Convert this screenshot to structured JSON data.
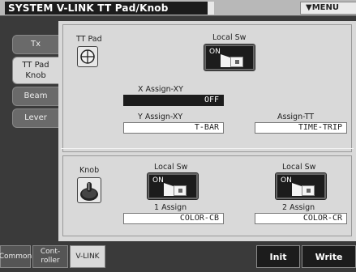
{
  "window": {
    "title": "SYSTEM V-LINK TT Pad/Knob",
    "menu_label": "▼MENU"
  },
  "side_tabs": [
    {
      "label_1": "Tx",
      "label_2": ""
    },
    {
      "label_1": "TT Pad",
      "label_2": "Knob"
    },
    {
      "label_1": "Beam",
      "label_2": ""
    },
    {
      "label_1": "Lever",
      "label_2": ""
    }
  ],
  "tt_pad": {
    "label": "TT Pad",
    "icon": "crosshair-pad-icon",
    "local_sw": {
      "label": "Local Sw",
      "state": "ON"
    },
    "x_assign": {
      "label": "X Assign-XY",
      "value": "OFF"
    },
    "y_assign": {
      "label": "Y Assign-XY",
      "value": "T-BAR"
    },
    "assign_tt": {
      "label": "Assign-TT",
      "value": "TIME-TRIP"
    }
  },
  "knob": {
    "label": "Knob",
    "icon": "knob-icon",
    "local_sw_1": {
      "label": "Local Sw",
      "state": "ON"
    },
    "local_sw_2": {
      "label": "Local Sw",
      "state": "ON"
    },
    "assign_1": {
      "label": "1 Assign",
      "value": "COLOR-CB"
    },
    "assign_2": {
      "label": "2 Assign",
      "value": "COLOR-CR"
    }
  },
  "bottom_tabs": [
    {
      "label_1": "Common",
      "label_2": ""
    },
    {
      "label_1": "Cont-",
      "label_2": "roller"
    },
    {
      "label_1": "V-LINK",
      "label_2": ""
    }
  ],
  "function_buttons": {
    "init": "Init",
    "write": "Write"
  },
  "colors": {
    "panel": "#d9d9d9",
    "dark": "#1c1c1c",
    "background": "#3a3a3a"
  }
}
